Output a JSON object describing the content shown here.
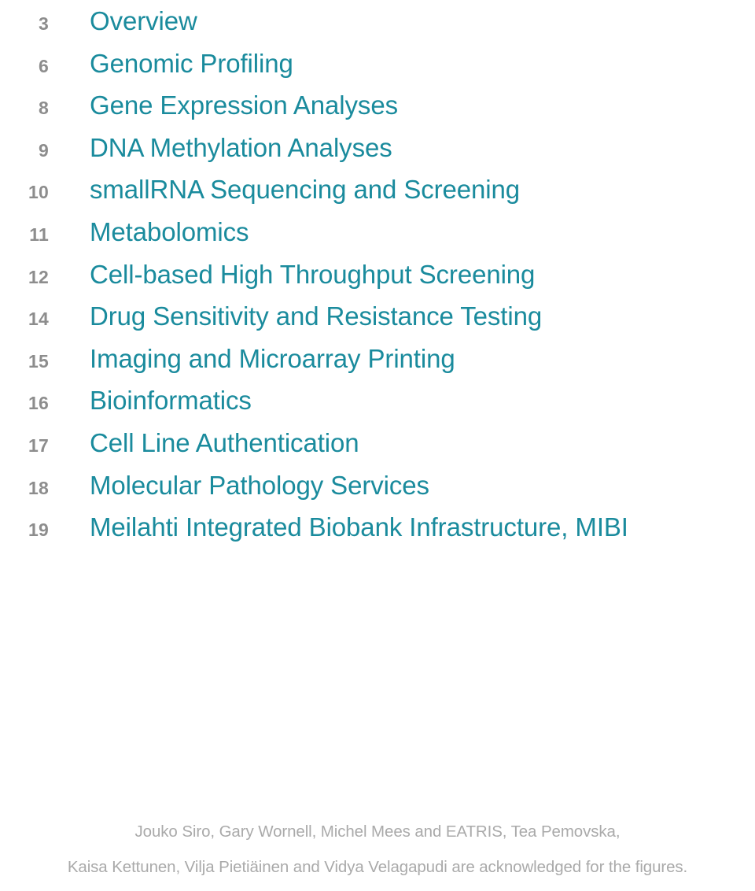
{
  "toc": {
    "entries": [
      {
        "page": "3",
        "title": "Overview"
      },
      {
        "page": "6",
        "title": "Genomic Profiling"
      },
      {
        "page": "8",
        "title": "Gene Expression Analyses"
      },
      {
        "page": "9",
        "title": "DNA Methylation Analyses"
      },
      {
        "page": "10",
        "title": "smallRNA Sequencing and Screening"
      },
      {
        "page": "11",
        "title": "Metabolomics"
      },
      {
        "page": "12",
        "title": "Cell-based High Throughput Screening"
      },
      {
        "page": "14",
        "title": "Drug Sensitivity and Resistance Testing"
      },
      {
        "page": "15",
        "title": "Imaging and Microarray Printing"
      },
      {
        "page": "16",
        "title": "Bioinformatics"
      },
      {
        "page": "17",
        "title": "Cell Line Authentication"
      },
      {
        "page": "18",
        "title": "Molecular Pathology Services"
      },
      {
        "page": "19",
        "title": "Meilahti Integrated Biobank Infrastructure, MIBI"
      }
    ]
  },
  "credits": {
    "line1": "Jouko Siro, Gary Wornell, Michel Mees and EATRIS, Tea Pemovska,",
    "line2": "Kaisa Kettunen, Vilja Pietiäinen and Vidya Velagapudi are acknowledged for the figures."
  },
  "colors": {
    "title_teal": "#1a8b9d",
    "page_number_gray": "#8d8d8d",
    "credits_gray": "#aaaaaa",
    "background": "#ffffff"
  }
}
